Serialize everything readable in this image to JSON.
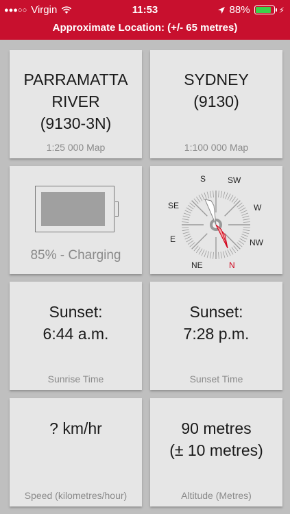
{
  "status_bar": {
    "signal_dots": "●●●○○",
    "carrier": "Virgin",
    "time": "11:53",
    "battery_percent": "88%",
    "battery_level": 0.88,
    "icons": [
      "wifi-icon",
      "location-arrow-icon",
      "battery-icon",
      "charging-bolt-icon"
    ]
  },
  "header": {
    "location_text": "Approximate Location: (+/- 65 metres)",
    "color": "#c8102e"
  },
  "tiles": {
    "map_25k": {
      "lines": [
        "PARRAMATTA",
        "RIVER",
        "(9130-3N)"
      ],
      "caption": "1:25 000 Map"
    },
    "map_100k": {
      "lines": [
        "SYDNEY",
        "(9130)"
      ],
      "caption": "1:100 000 Map"
    },
    "battery": {
      "text": "85% - Charging",
      "level": 0.85
    },
    "compass": {
      "labels": [
        "S",
        "SW",
        "W",
        "SE",
        "E",
        "NW",
        "NE",
        "N"
      ],
      "north_color": "#d0021b"
    },
    "sunrise": {
      "lines": [
        "Sunset:",
        "6:44 a.m."
      ],
      "caption": "Sunrise Time"
    },
    "sunset": {
      "lines": [
        "Sunset:",
        "7:28 p.m."
      ],
      "caption": "Sunset Time"
    },
    "speed": {
      "lines": [
        "? km/hr"
      ],
      "caption": "Speed (kilometres/hour)"
    },
    "altitude": {
      "lines": [
        "90 metres",
        "(± 10 metres)"
      ],
      "caption": "Altitude (Metres)"
    }
  }
}
